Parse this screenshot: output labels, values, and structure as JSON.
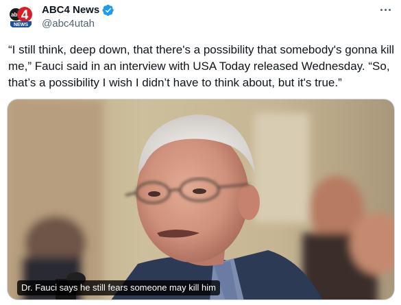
{
  "author": {
    "display_name": "ABC4 News",
    "handle": "@abc4utah",
    "verified": true,
    "avatar_icon": "abc4-news-logo-icon",
    "avatar_text_abc": "abc",
    "avatar_text_num": "4",
    "avatar_text_news": "NEWS"
  },
  "more_icon": "more-options-icon",
  "tweet": {
    "text": "“I still think, deep down, that there's a possibility that somebody's gonna kill me,” Fauci said in an interview with USA Today released Wednesday. “So, that’s a possibility I wish I didn’t have to think about, but it's true.”"
  },
  "media": {
    "caption": "Dr. Fauci says he still fears someone may kill him"
  },
  "colors": {
    "verified_blue": "#1d9bf0",
    "handle_gray": "#536471",
    "text": "#0f1419",
    "logo_red": "#d3202a",
    "logo_blue": "#1b4f9c"
  }
}
